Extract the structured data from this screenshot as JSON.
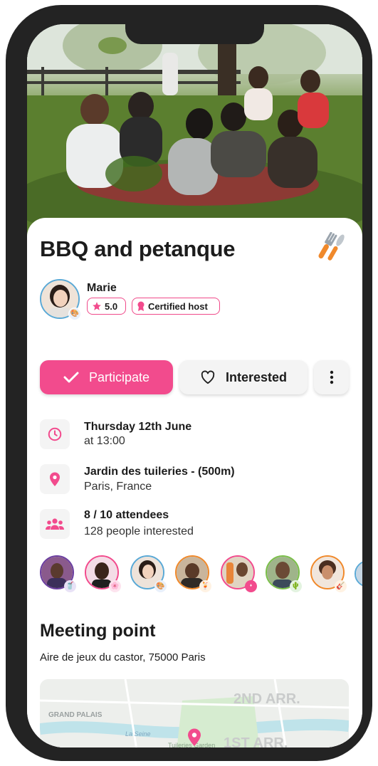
{
  "event": {
    "title": "BBQ and petanque",
    "category_icon": "cutlery-icon"
  },
  "host": {
    "name": "Marie",
    "rating": "5.0",
    "certified_label": "Certified host"
  },
  "actions": {
    "participate_label": "Participate",
    "interested_label": "Interested"
  },
  "details": {
    "date": "Thursday 12th June",
    "time": "at 13:00",
    "place": "Jardin des tuileries - (500m)",
    "city": "Paris, France",
    "attendees": "8 / 10 attendees",
    "interested": "128 people interested"
  },
  "attendee_ring_colors": [
    "#6b3fa0",
    "#f24b8d",
    "#5aa9d6",
    "#f0892b",
    "#f24b8d",
    "#7bbf4a",
    "#f0892b",
    "#5aa9d6"
  ],
  "meeting": {
    "section_title": "Meeting point",
    "address": "Aire de jeux du castor, 75000 Paris"
  },
  "map": {
    "labels": [
      "2ND ARR.",
      "GRAND PALAIS",
      "La Seine",
      "Tuileries Garden",
      "1ST ARR."
    ]
  },
  "colors": {
    "accent": "#f24b8d",
    "text": "#1c1c1c"
  }
}
